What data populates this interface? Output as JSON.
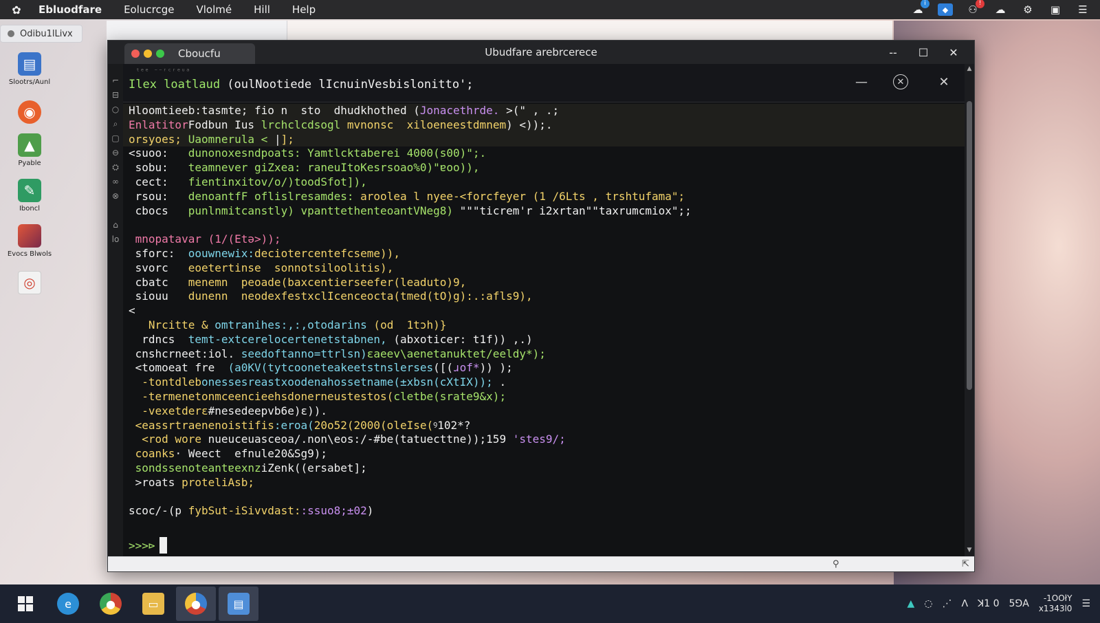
{
  "menubar": {
    "app_name": "Ebluodfare",
    "menus": [
      "Eolucrcge",
      "Vlolmé",
      "Hill",
      "Help"
    ]
  },
  "desktop": {
    "pill_label": "Odibu1lLivx",
    "icons": [
      {
        "label": "Slootrs/Aunl",
        "icon": "document-icon",
        "color": "#3b74c9"
      },
      {
        "label": "",
        "icon": "firefox-icon",
        "color": "#e8602c"
      },
      {
        "label": "Pyable",
        "icon": "image-icon",
        "color": "#4f9d4a"
      },
      {
        "label": "Iboncl",
        "icon": "pencil-icon",
        "color": "#2f9b63"
      },
      {
        "label": "Evocs Blwols",
        "icon": "gradient-icon",
        "color": "#c64b2f"
      },
      {
        "label": "",
        "icon": "chrome-icon",
        "color": "#d04333"
      }
    ]
  },
  "window": {
    "tab_title": "Cboucfu",
    "title": "Ubudfare arebrcerece",
    "minimize_label": "--",
    "maximize_label": "☐",
    "close_label": "✕"
  },
  "pane": {
    "ghost": "ᵗᵉᵉ  ⁻⁻ʳᶜʳᵉᵘᵃ",
    "head_green": "Ilex loatlaud",
    "head_rest": " (oulNootiede lIcnuinVesbislonitto';"
  },
  "gutter_icons": [
    "⌐",
    "⊟",
    "○",
    "⌕",
    "▢",
    "⊖",
    "⛭",
    "∞",
    "⊗",
    "",
    "⌂",
    "lo"
  ],
  "code_lines": [
    [
      {
        "t": "Hloomtieeb:tasmte; fio n  sto  dhudkhothed (",
        "c": "c-white"
      },
      {
        "t": "Jonacethrde.",
        "c": "c-purple"
      },
      {
        "t": " >(\" , .;",
        "c": "c-white"
      }
    ],
    [
      {
        "t": "Enlatitor",
        "c": "c-pink"
      },
      {
        "t": "Fodbun Ius",
        "c": "c-white"
      },
      {
        "t": " lrchclcdsogl",
        "c": "c-green"
      },
      {
        "t": " mvnonsc  xiloeneestdmnem",
        "c": "c-yellow"
      },
      {
        "t": ") <));.",
        "c": "c-white"
      }
    ],
    [
      {
        "t": "orsyoes; ",
        "c": "c-yellow"
      },
      {
        "t": "Uaomnerula < ",
        "c": "c-green"
      },
      {
        "t": "|",
        "c": "c-white"
      },
      {
        "t": "];",
        "c": "c-yellow"
      }
    ],
    [
      {
        "t": "<suoo:   ",
        "c": "c-white"
      },
      {
        "t": "dunonoxesndpoats: Yamtlcktaberei 4000(s00)\";.",
        "c": "c-green"
      }
    ],
    [
      {
        "t": " sobu:   ",
        "c": "c-white"
      },
      {
        "t": "teamnever giZxea: raneuItoKesrsoao%0)\"ɐoo)),",
        "c": "c-green"
      }
    ],
    [
      {
        "t": " cect:   ",
        "c": "c-white"
      },
      {
        "t": "fientinxitov/o/)toodSfot]),",
        "c": "c-green"
      }
    ],
    [
      {
        "t": " rsou:   ",
        "c": "c-white"
      },
      {
        "t": "denoantfF oflislresamdes: ",
        "c": "c-green"
      },
      {
        "t": "aroolea l nyee-<forcfeyer (1 /6Lts , trshtufama\";",
        "c": "c-yellow"
      }
    ],
    [
      {
        "t": " cbocs   ",
        "c": "c-white"
      },
      {
        "t": "punlnmitcanstly) vpanttethenteoantVNeg8)",
        "c": "c-green"
      },
      {
        "t": " \"\"\"ticrem'r i2xrtan\"\"taxrumcmiox\";;",
        "c": "c-white"
      }
    ],
    [
      {
        "t": "",
        "c": "c-white"
      }
    ],
    [
      {
        "t": " mnopatavar (1/(Etə>));",
        "c": "c-pink"
      }
    ],
    [
      {
        "t": " sforc:  ",
        "c": "c-white"
      },
      {
        "t": "oouwnewix:",
        "c": "c-cyan"
      },
      {
        "t": "deciotercentefcseme)),",
        "c": "c-yellow"
      }
    ],
    [
      {
        "t": " svorc   ",
        "c": "c-white"
      },
      {
        "t": "eoetertinse  sonnotsiloolitis),",
        "c": "c-yellow"
      }
    ],
    [
      {
        "t": " cbatc   ",
        "c": "c-white"
      },
      {
        "t": "menemn  peoade(baxcentierseefer(leaduto)9,",
        "c": "c-yellow"
      }
    ],
    [
      {
        "t": " siouu   ",
        "c": "c-white"
      },
      {
        "t": "dunenn  neodexfestxclIcenceocta(tmed(tO)g):.:afls9),",
        "c": "c-yellow"
      }
    ],
    [
      {
        "t": "<",
        "c": "c-white"
      }
    ],
    [
      {
        "t": "   Nrcitte & ",
        "c": "c-yellow"
      },
      {
        "t": "omtranihes:,:,otodarins",
        "c": "c-cyan"
      },
      {
        "t": " (od  1tɔh)}",
        "c": "c-yellow"
      }
    ],
    [
      {
        "t": "  rdncs  ",
        "c": "c-white"
      },
      {
        "t": "temt",
        "c": "c-cyan"
      },
      {
        "t": "-extcerelocertenetstabnen,",
        "c": "c-cyan"
      },
      {
        "t": " (abxoticer: t1f)) ,.)",
        "c": "c-white"
      }
    ],
    [
      {
        "t": " cnshcrneet:iol.",
        "c": "c-white"
      },
      {
        "t": " seedoftanno=ttrlsn)",
        "c": "c-cyan"
      },
      {
        "t": "ɛaeev\\aenetanuktet/eeldy*);",
        "c": "c-green"
      }
    ],
    [
      {
        "t": " <tomoeat fre  ",
        "c": "c-white"
      },
      {
        "t": "(a0KV(tytcooneteakeetstnslerses",
        "c": "c-cyan"
      },
      {
        "t": "([(",
        "c": "c-white"
      },
      {
        "t": "ɹof*",
        "c": "c-purple"
      },
      {
        "t": ")) );",
        "c": "c-white"
      }
    ],
    [
      {
        "t": "  -tontdleb",
        "c": "c-yellow"
      },
      {
        "t": "onessesreastxoodenahossetname(±xbsn(cXtIX));",
        "c": "c-cyan"
      },
      {
        "t": " .",
        "c": "c-white"
      }
    ],
    [
      {
        "t": "  -termenetonmceencieehsdonerneustestos(",
        "c": "c-yellow"
      },
      {
        "t": "cletbe(srate9&x);",
        "c": "c-green"
      }
    ],
    [
      {
        "t": "  -vexetderɛ",
        "c": "c-yellow"
      },
      {
        "t": "#nesedeepvb6e)ɛ)).",
        "c": "c-white"
      }
    ],
    [
      {
        "t": " <eassrtraenenoistifis",
        "c": "c-yellow"
      },
      {
        "t": ":eroa(",
        "c": "c-cyan"
      },
      {
        "t": "20o52(2000(oleIse(",
        "c": "c-yellow"
      },
      {
        "t": "ꝰ102*?",
        "c": "c-white"
      }
    ],
    [
      {
        "t": "  <rod wore ",
        "c": "c-yellow"
      },
      {
        "t": "nueuceuasceoa/.non\\eos:/-#be(tatuecttne));159",
        "c": "c-white"
      },
      {
        "t": " 'stes9/;",
        "c": "c-purple"
      }
    ],
    [
      {
        "t": " coanks",
        "c": "c-yellow"
      },
      {
        "t": "· Weect  efnule20&Sg9);",
        "c": "c-white"
      }
    ],
    [
      {
        "t": " sondssenoteantɐexnz",
        "c": "c-green"
      },
      {
        "t": "iZenk((ersabet];",
        "c": "c-white"
      }
    ],
    [
      {
        "t": " >roats ",
        "c": "c-white"
      },
      {
        "t": "proteliAsb;",
        "c": "c-yellow"
      }
    ],
    [
      {
        "t": "",
        "c": "c-white"
      }
    ],
    [
      {
        "t": "scoc/-(p ",
        "c": "c-white"
      },
      {
        "t": "fybSut-iSivvdast:",
        "c": "c-yellow"
      },
      {
        "t": ":ssuo8;±02",
        "c": "c-purple"
      },
      {
        "t": ")",
        "c": "c-white"
      }
    ]
  ],
  "prompt": ">>>⊳",
  "taskbar": {
    "apps": [
      {
        "icon": "edge-icon",
        "color": "#2c8fd6"
      },
      {
        "icon": "chrome-icon",
        "color": "#d04333"
      },
      {
        "icon": "folder-icon",
        "color": "#e7b94a"
      },
      {
        "icon": "chrome-icon",
        "color": "#3b7fd0"
      },
      {
        "icon": "window-icon",
        "color": "#4f8ed8"
      }
    ],
    "tray_text_1": "ꓘ1 0",
    "tray_text_2": "5⅁A",
    "clock_time": "-1OOłY",
    "clock_date": "x1343l0"
  }
}
